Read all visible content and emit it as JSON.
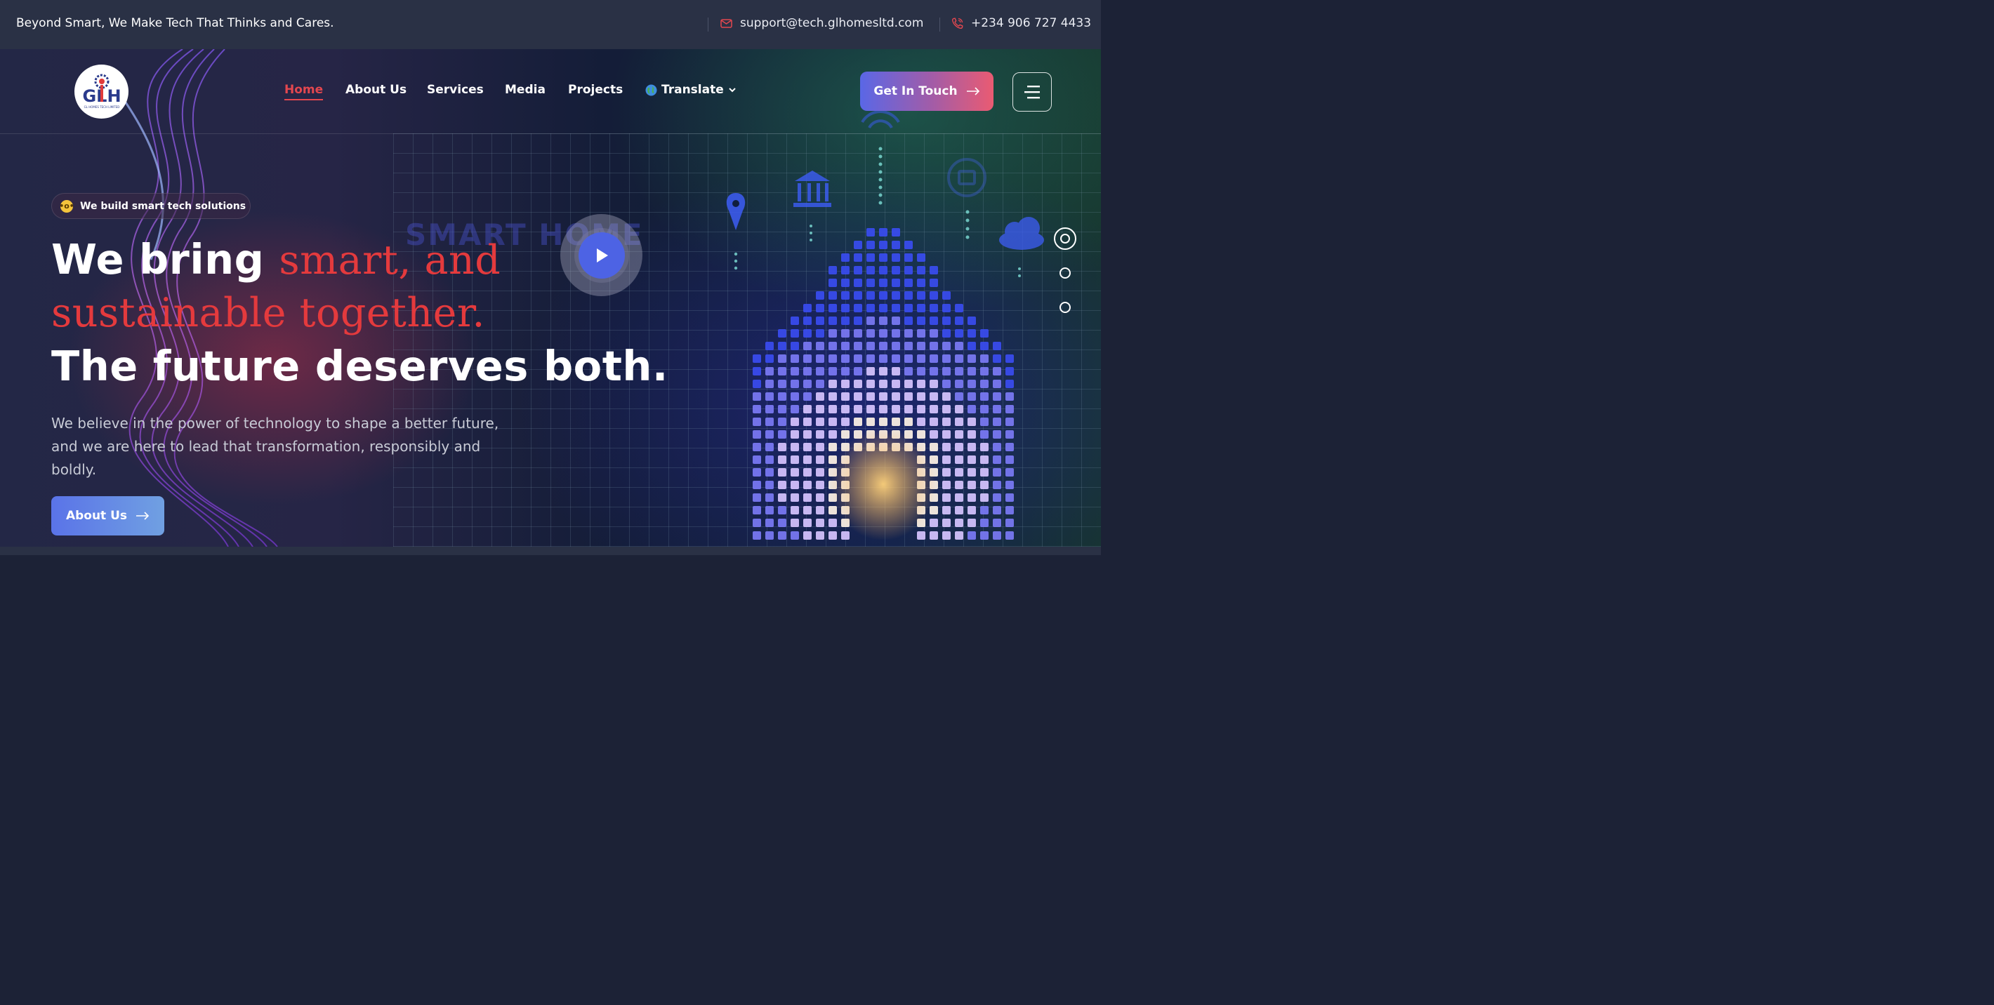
{
  "topbar": {
    "tagline": "Beyond Smart, We Make Tech That Thinks and Cares.",
    "email": "support@tech.glhomesltd.com",
    "phone": "+234 906 727 4433",
    "email_icon": "mail-icon",
    "phone_icon": "phone-icon"
  },
  "logo": {
    "letters": "GLH",
    "subtitle": "GL HOMES TECH LIMITED"
  },
  "nav": {
    "items": [
      {
        "label": "Home",
        "active": true
      },
      {
        "label": "About Us"
      },
      {
        "label": "Services"
      },
      {
        "label": "Media"
      },
      {
        "label": "Projects"
      }
    ],
    "translate_label": "Translate",
    "translate_icon": "globe-icon"
  },
  "cta": {
    "label": "Get In Touch"
  },
  "hero": {
    "badge": "We build smart tech solutions",
    "headline_line1_plain": "We bring ",
    "headline_line1_accent": "smart, and",
    "headline_line2_accent": "sustainable together.",
    "headline_line3": "The future deserves both.",
    "paragraph": "We believe in the power of technology to shape a better future, and we are here to lead that transformation, responsibly and boldly.",
    "button_label": "About Us",
    "watermark": "SMART HOME",
    "slide_count": 3,
    "active_slide": 1
  },
  "colors": {
    "accent_red": "#e43a3d",
    "cta_start": "#5a67e6",
    "cta_end": "#ea5b72",
    "topbar_bg": "#2a3145"
  }
}
